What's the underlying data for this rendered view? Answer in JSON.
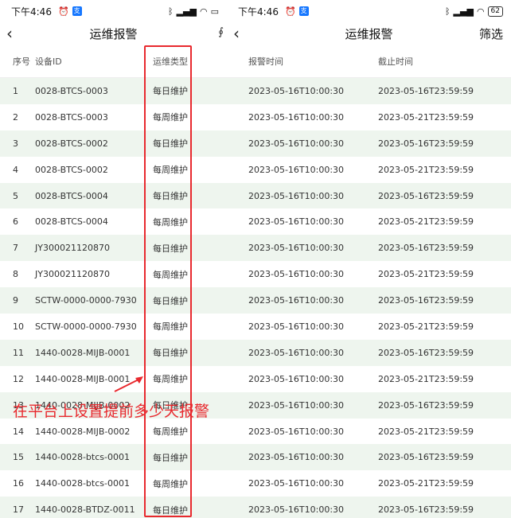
{
  "status": {
    "time": "下午4:46",
    "battery": "62"
  },
  "nav": {
    "title": "运维报警",
    "filter_label": "筛选"
  },
  "headers": {
    "index": "序号",
    "device": "设备ID",
    "type": "运维类型",
    "report_time": "报警时间",
    "deadline": "截止时间"
  },
  "rows": [
    {
      "idx": "1",
      "device": "0028-BTCS-0003",
      "type": "每日维护",
      "report": "2023-05-16T10:00:30",
      "end": "2023-05-16T23:59:59"
    },
    {
      "idx": "2",
      "device": "0028-BTCS-0003",
      "type": "每周维护",
      "report": "2023-05-16T10:00:30",
      "end": "2023-05-21T23:59:59"
    },
    {
      "idx": "3",
      "device": "0028-BTCS-0002",
      "type": "每日维护",
      "report": "2023-05-16T10:00:30",
      "end": "2023-05-16T23:59:59"
    },
    {
      "idx": "4",
      "device": "0028-BTCS-0002",
      "type": "每周维护",
      "report": "2023-05-16T10:00:30",
      "end": "2023-05-21T23:59:59"
    },
    {
      "idx": "5",
      "device": "0028-BTCS-0004",
      "type": "每日维护",
      "report": "2023-05-16T10:00:30",
      "end": "2023-05-16T23:59:59"
    },
    {
      "idx": "6",
      "device": "0028-BTCS-0004",
      "type": "每周维护",
      "report": "2023-05-16T10:00:30",
      "end": "2023-05-21T23:59:59"
    },
    {
      "idx": "7",
      "device": "JY300021120870",
      "type": "每日维护",
      "report": "2023-05-16T10:00:30",
      "end": "2023-05-16T23:59:59"
    },
    {
      "idx": "8",
      "device": "JY300021120870",
      "type": "每周维护",
      "report": "2023-05-16T10:00:30",
      "end": "2023-05-21T23:59:59"
    },
    {
      "idx": "9",
      "device": "SCTW-0000-0000-7930",
      "type": "每日维护",
      "report": "2023-05-16T10:00:30",
      "end": "2023-05-16T23:59:59"
    },
    {
      "idx": "10",
      "device": "SCTW-0000-0000-7930",
      "type": "每周维护",
      "report": "2023-05-16T10:00:30",
      "end": "2023-05-21T23:59:59"
    },
    {
      "idx": "11",
      "device": "1440-0028-MIJB-0001",
      "type": "每日维护",
      "report": "2023-05-16T10:00:30",
      "end": "2023-05-16T23:59:59"
    },
    {
      "idx": "12",
      "device": "1440-0028-MIJB-0001",
      "type": "每周维护",
      "report": "2023-05-16T10:00:30",
      "end": "2023-05-21T23:59:59"
    },
    {
      "idx": "13",
      "device": "1440-0028-MIJB-0002",
      "type": "每日维护",
      "report": "2023-05-16T10:00:30",
      "end": "2023-05-16T23:59:59"
    },
    {
      "idx": "14",
      "device": "1440-0028-MIJB-0002",
      "type": "每周维护",
      "report": "2023-05-16T10:00:30",
      "end": "2023-05-21T23:59:59"
    },
    {
      "idx": "15",
      "device": "1440-0028-btcs-0001",
      "type": "每日维护",
      "report": "2023-05-16T10:00:30",
      "end": "2023-05-16T23:59:59"
    },
    {
      "idx": "16",
      "device": "1440-0028-btcs-0001",
      "type": "每周维护",
      "report": "2023-05-16T10:00:30",
      "end": "2023-05-21T23:59:59"
    },
    {
      "idx": "17",
      "device": "1440-0028-BTDZ-0011",
      "type": "每日维护",
      "report": "2023-05-16T10:00:30",
      "end": "2023-05-16T23:59:59"
    }
  ],
  "annotation": {
    "text": "在平台上设置提前多少天报警",
    "color": "#e8292e"
  },
  "colors": {
    "row_alt": "#eef5ee",
    "highlight": "#e8292e"
  }
}
